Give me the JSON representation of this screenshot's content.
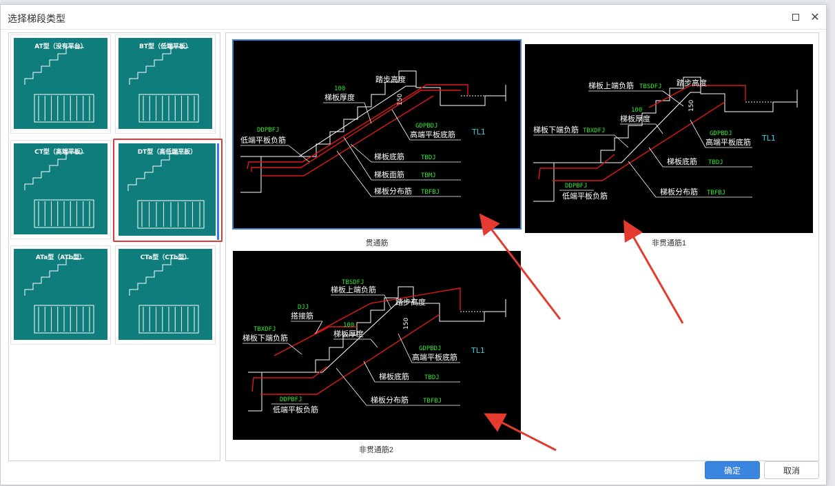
{
  "dialog": {
    "title": "选择梯段类型",
    "ok_label": "确定",
    "cancel_label": "取消"
  },
  "stair_types": [
    {
      "label": "AT型（没有平台）",
      "selected": false
    },
    {
      "label": "BT型（低端平板）",
      "selected": false
    },
    {
      "label": "CT型（高端平板）",
      "selected": false
    },
    {
      "label": "DT型（高低端平板）",
      "selected": true
    },
    {
      "label": "ATa型（ATb型）",
      "selected": false
    },
    {
      "label": "CTa型（CTb型）",
      "selected": false
    }
  ],
  "rebar_options": [
    {
      "caption": "贯通筋",
      "selected": true,
      "labels": {
        "step_height": "踏步高度",
        "h150": "150",
        "t100": "100",
        "thickness": "梯板厚度",
        "ddpbfj": "DDPBFJ",
        "low_neg": "低端平板负筋",
        "gdpbdj": "GDPBDJ",
        "high_bottom": "高端平板底筋",
        "tl1": "TL1",
        "bottom_bar": "梯板底筋",
        "tbdj": "TBDJ",
        "face_bar": "梯板面筋",
        "tbmj": "TBMJ",
        "dist_bar": "梯板分布筋",
        "tbfbj": "TBFBJ"
      }
    },
    {
      "caption": "非贯通筋1",
      "selected": false,
      "labels": {
        "upper_neg": "梯板上端负筋",
        "tbsdfj": "TBSDFJ",
        "step_height": "踏步高度",
        "h150": "150",
        "t100": "100",
        "thickness": "梯板厚度",
        "lower_neg": "梯板下端负筋",
        "tbxdfj": "TBXDFJ",
        "gdpbdj": "GDPBDJ",
        "high_bottom": "高端平板底筋",
        "tl1": "TL1",
        "bottom_bar": "梯板底筋",
        "tbdj": "TBDJ",
        "ddpbfj": "DDPBFJ",
        "low_neg": "低端平板负筋",
        "dist_bar": "梯板分布筋",
        "tbfbj": "TBFBJ"
      }
    },
    {
      "caption": "非贯通筋2",
      "selected": false,
      "labels": {
        "tbsdfj": "TBSDFJ",
        "upper_neg": "梯板上端负筋",
        "step_height": "踏步高度",
        "h150": "150",
        "djj": "DJJ",
        "lap_bar": "搭接筋",
        "tbxdfj": "TBXDFJ",
        "lower_neg": "梯板下端负筋",
        "t100": "100",
        "thickness": "梯板厚度",
        "gdpbdj": "GDPBDJ",
        "high_bottom": "高端平板底筋",
        "tl1": "TL1",
        "bottom_bar": "梯板底筋",
        "tbdj": "TBDJ",
        "ddpbfj": "DDPBFJ",
        "low_neg": "低端平板负筋",
        "dist_bar": "梯板分布筋",
        "tbfbj": "TBFBJ"
      }
    }
  ],
  "colors": {
    "thumb_bg": "#0e7d7b",
    "rebar": "#e01818",
    "code_text": "#2ee82e",
    "tl_text": "#35d3e0",
    "primary": "#3a85e0",
    "highlight": "#e03a3a"
  }
}
